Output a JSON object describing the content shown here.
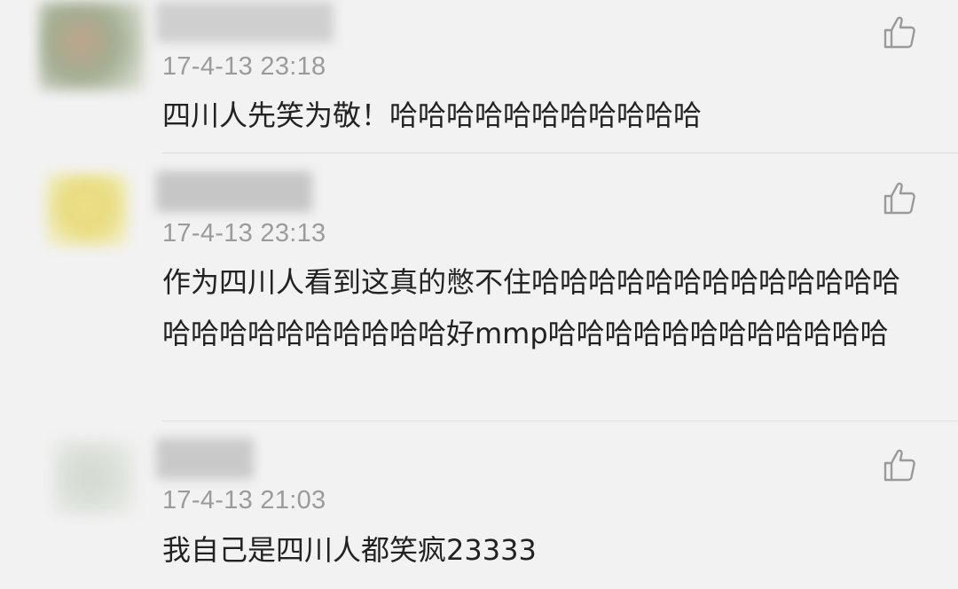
{
  "comments": [
    {
      "timestamp": "17-4-13 23:18",
      "text": "四川人先笑为敬！哈哈哈哈哈哈哈哈哈哈哈",
      "like_icon": "thumbs-up-icon"
    },
    {
      "timestamp": "17-4-13 23:13",
      "text": "作为四川人看到这真的憋不住哈哈哈哈哈哈哈哈哈哈哈哈哈哈哈哈哈哈哈哈哈哈哈好mmp哈哈哈哈哈哈哈哈哈哈哈哈",
      "like_icon": "thumbs-up-icon"
    },
    {
      "timestamp": "17-4-13 21:03",
      "text": "我自己是四川人都笑疯23333",
      "like_icon": "thumbs-up-icon"
    }
  ],
  "colors": {
    "background": "#f2f2f2",
    "text": "#222222",
    "timestamp": "#9b9b9b",
    "divider": "#dddddd",
    "icon": "#9a9a9a"
  }
}
